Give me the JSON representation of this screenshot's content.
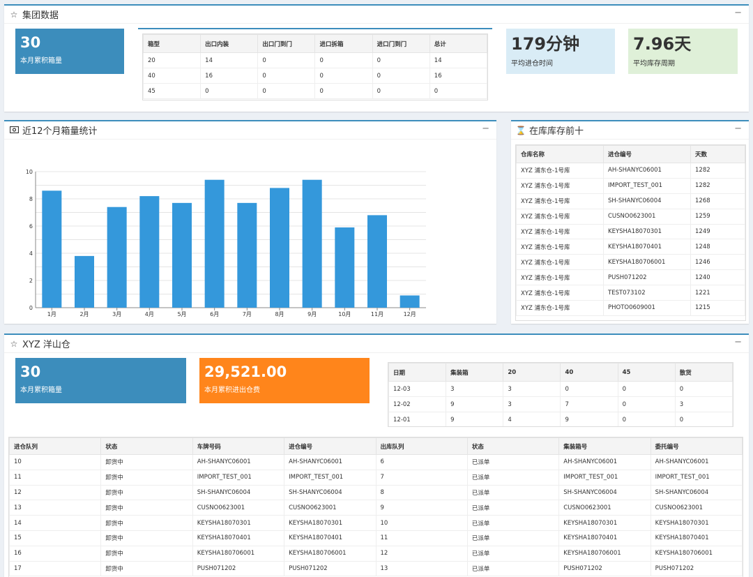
{
  "group": {
    "title": "集团数据",
    "collapse": "−",
    "stat1": {
      "value": "30",
      "label": "本月累积箱量"
    },
    "stat2": {
      "value": "179分钟",
      "label": "平均进仓时间"
    },
    "stat3": {
      "value": "7.96天",
      "label": "平均库存周期"
    },
    "table": {
      "headers": [
        "箱型",
        "出口内装",
        "出口门到门",
        "进口拆箱",
        "进口门到门",
        "总计"
      ],
      "rows": [
        [
          "20",
          "14",
          "0",
          "0",
          "0",
          "14"
        ],
        [
          "40",
          "16",
          "0",
          "0",
          "0",
          "16"
        ],
        [
          "45",
          "0",
          "0",
          "0",
          "0",
          "0"
        ]
      ]
    }
  },
  "chart_panel": {
    "title": "近12个月箱量统计",
    "collapse": "−"
  },
  "chart_data": {
    "type": "bar",
    "categories": [
      "1月",
      "2月",
      "3月",
      "4月",
      "5月",
      "6月",
      "7月",
      "8月",
      "9月",
      "10月",
      "11月",
      "12月"
    ],
    "values": [
      8.6,
      3.8,
      7.4,
      8.2,
      7.7,
      9.4,
      7.7,
      8.8,
      9.4,
      5.9,
      6.8,
      0.9
    ],
    "yticks": [
      "0",
      "2",
      "4",
      "6",
      "8",
      "10"
    ],
    "ylim": [
      0,
      10
    ],
    "grid": true,
    "color": "#3498db"
  },
  "top10": {
    "title": "在库库存前十",
    "collapse": "−",
    "headers": [
      "仓库名称",
      "进仓编号",
      "天数"
    ],
    "rows": [
      [
        "XYZ 浦东仓-1号库",
        "AH-SHANYC06001",
        "1282"
      ],
      [
        "XYZ 浦东仓-1号库",
        "IMPORT_TEST_001",
        "1282"
      ],
      [
        "XYZ 浦东仓-1号库",
        "SH-SHANYC06004",
        "1268"
      ],
      [
        "XYZ 浦东仓-1号库",
        "CUSNO0623001",
        "1259"
      ],
      [
        "XYZ 浦东仓-1号库",
        "KEYSHA18070301",
        "1249"
      ],
      [
        "XYZ 浦东仓-1号库",
        "KEYSHA18070401",
        "1248"
      ],
      [
        "XYZ 浦东仓-1号库",
        "KEYSHA180706001",
        "1246"
      ],
      [
        "XYZ 浦东仓-1号库",
        "PUSH071202",
        "1240"
      ],
      [
        "XYZ 浦东仓-1号库",
        "TEST073102",
        "1221"
      ],
      [
        "XYZ 浦东仓-1号库",
        "PHOTO0609001",
        "1215"
      ]
    ]
  },
  "yangshan": {
    "title": "XYZ 洋山仓",
    "collapse": "−",
    "stat1": {
      "value": "30",
      "label": "本月累积箱量"
    },
    "stat2": {
      "value": "29,521.00",
      "label": "本月累积进出仓费"
    },
    "daily": {
      "headers": [
        "日期",
        "集装箱",
        "20",
        "40",
        "45",
        "散货"
      ],
      "rows": [
        [
          "12-03",
          "3",
          "3",
          "0",
          "0",
          "0"
        ],
        [
          "12-02",
          "9",
          "3",
          "7",
          "0",
          "3"
        ],
        [
          "12-01",
          "9",
          "4",
          "9",
          "0",
          "0"
        ]
      ]
    },
    "queue_headers": [
      "进仓队列",
      "状态",
      "车牌号码",
      "进仓编号",
      "出库队列",
      "状态",
      "集装箱号",
      "委托编号"
    ],
    "queue_rows": [
      [
        "10",
        "卸货中",
        "AH-SHANYC06001",
        "AH-SHANYC06001",
        "6",
        "已派单",
        "AH-SHANYC06001",
        "AH-SHANYC06001"
      ],
      [
        "11",
        "卸货中",
        "IMPORT_TEST_001",
        "IMPORT_TEST_001",
        "7",
        "已派单",
        "IMPORT_TEST_001",
        "IMPORT_TEST_001"
      ],
      [
        "12",
        "卸货中",
        "SH-SHANYC06004",
        "SH-SHANYC06004",
        "8",
        "已派单",
        "SH-SHANYC06004",
        "SH-SHANYC06004"
      ],
      [
        "13",
        "卸货中",
        "CUSNO0623001",
        "CUSNO0623001",
        "9",
        "已派单",
        "CUSNO0623001",
        "CUSNO0623001"
      ],
      [
        "14",
        "卸货中",
        "KEYSHA18070301",
        "KEYSHA18070301",
        "10",
        "已派单",
        "KEYSHA18070301",
        "KEYSHA18070301"
      ],
      [
        "15",
        "卸货中",
        "KEYSHA18070401",
        "KEYSHA18070401",
        "11",
        "已派单",
        "KEYSHA18070401",
        "KEYSHA18070401"
      ],
      [
        "16",
        "卸货中",
        "KEYSHA180706001",
        "KEYSHA180706001",
        "12",
        "已派单",
        "KEYSHA180706001",
        "KEYSHA180706001"
      ],
      [
        "17",
        "卸货中",
        "PUSH071202",
        "PUSH071202",
        "13",
        "已派单",
        "PUSH071202",
        "PUSH071202"
      ]
    ]
  }
}
